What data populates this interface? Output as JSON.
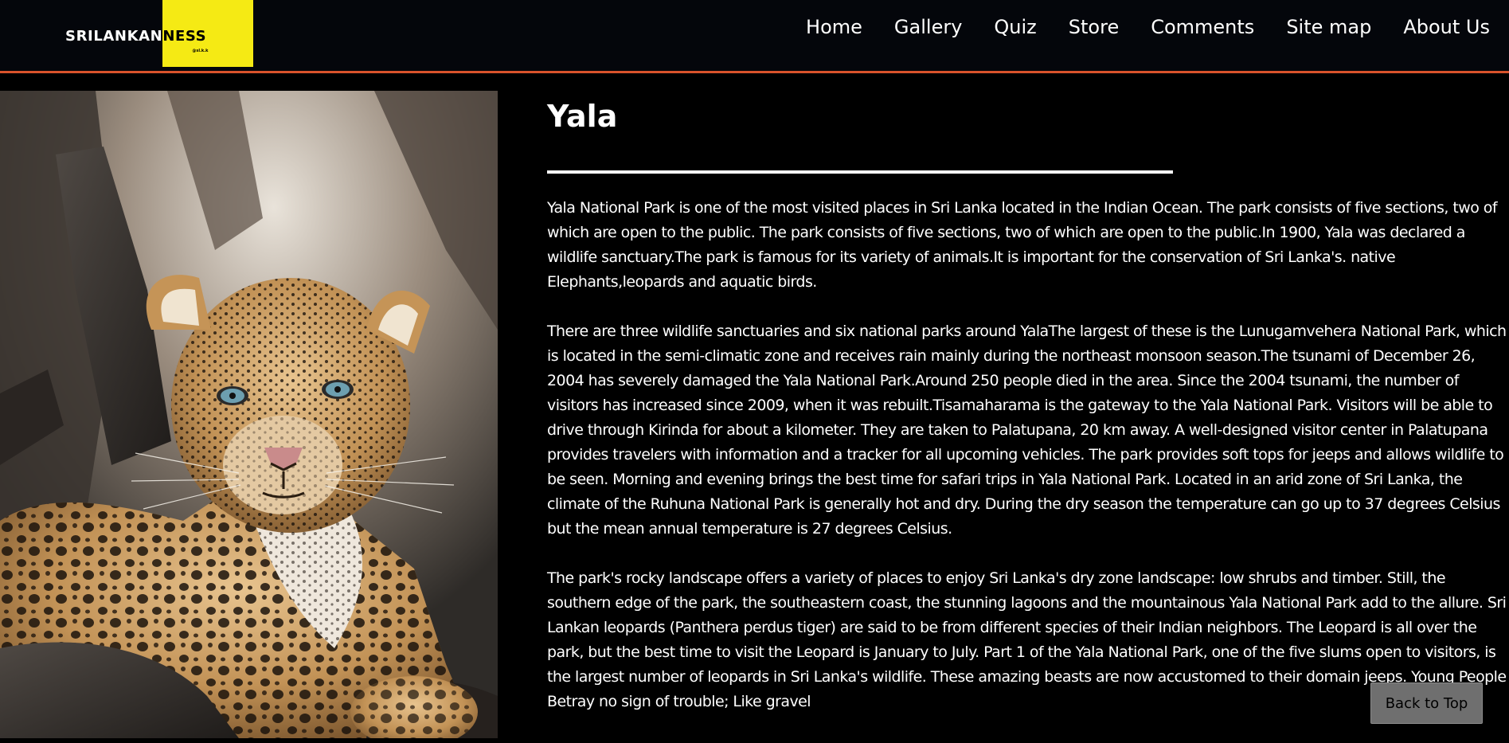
{
  "header": {
    "logo_left": "SRILANKAN",
    "logo_right": "NESS",
    "logo_sub": "@sl.k.k",
    "accent_color": "#d9532b",
    "logo_box_color": "#f5ea14"
  },
  "nav": {
    "items": [
      {
        "label": "Home"
      },
      {
        "label": "Gallery"
      },
      {
        "label": "Quiz"
      },
      {
        "label": "Store"
      },
      {
        "label": "Comments"
      },
      {
        "label": "Site map"
      },
      {
        "label": "About Us"
      }
    ]
  },
  "hero": {
    "image_subject": "leopard"
  },
  "article": {
    "title": "Yala",
    "paragraphs": [
      "Yala National Park is one of the most visited places in Sri Lanka located in the Indian Ocean. The park consists of five sections, two of which are open to the public. The park consists of five sections, two of which are open to the public.In 1900, Yala was declared a wildlife sanctuary.The park is famous for its variety of animals.It is important for the conservation of Sri Lanka's. native Elephants,leopards and aquatic birds.",
      "There are three wildlife sanctuaries and six national parks around YalaThe largest of these is the Lunugamvehera National Park, which is located in the semi-climatic zone and receives rain mainly during the northeast monsoon season.The tsunami of December 26, 2004 has severely damaged the Yala National Park.Around 250 people died in the area. Since the 2004 tsunami, the number of visitors has increased since 2009, when it was rebuilt.Tisamaharama is the gateway to the Yala National Park. Visitors will be able to drive through Kirinda for about a kilometer. They are taken to Palatupana, 20 km away. A well-designed visitor center in Palatupana provides travelers with information and a tracker for all upcoming vehicles. The park provides soft tops for jeeps and allows wildlife to be seen. Morning and evening brings the best time for safari trips in Yala National Park. Located in an arid zone of Sri Lanka, the climate of the Ruhuna National Park is generally hot and dry. During the dry season the temperature can go up to 37 degrees Celsius but the mean annual temperature is 27 degrees Celsius.",
      "The park's rocky landscape offers a variety of places to enjoy Sri Lanka's dry zone landscape: low shrubs and timber. Still, the southern edge of the park, the southeastern coast, the stunning lagoons and the mountainous Yala National Park add to the allure. Sri Lankan leopards (Panthera perdus tiger) are said to be from different species of their Indian neighbors. The Leopard is all over the park, but the best time to visit the Leopard is January to July. Part 1 of the Yala National Park, one of the five slums open to visitors, is the largest number of leopards in Sri Lanka's wildlife. These amazing beasts are now accustomed to their domain jeeps. Young People Betray no sign of trouble; Like gravel"
    ]
  },
  "back_to_top": {
    "label": "Back to Top"
  }
}
